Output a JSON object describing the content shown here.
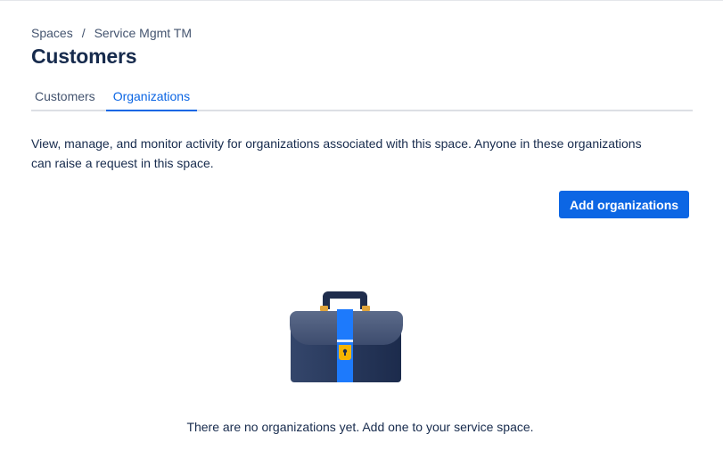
{
  "breadcrumb": {
    "items": [
      "Spaces",
      "Service Mgmt TM"
    ],
    "separator": "/"
  },
  "page": {
    "title": "Customers"
  },
  "tabs": [
    {
      "label": "Customers",
      "active": false
    },
    {
      "label": "Organizations",
      "active": true
    }
  ],
  "content": {
    "description": "View, manage, and monitor activity for organizations associated with this space. Anyone in these organizations can raise a request in this space.",
    "add_button_label": "Add organizations",
    "empty_message": "There are no organizations yet. Add one to your service space.",
    "illustration_icon": "briefcase-icon"
  },
  "colors": {
    "accent": "#0c66e4",
    "text": "#172b4d",
    "subtle_text": "#44546f",
    "briefcase_body": "#2c3e63",
    "briefcase_strap": "#1d7afc",
    "briefcase_clasp": "#f5b400"
  }
}
